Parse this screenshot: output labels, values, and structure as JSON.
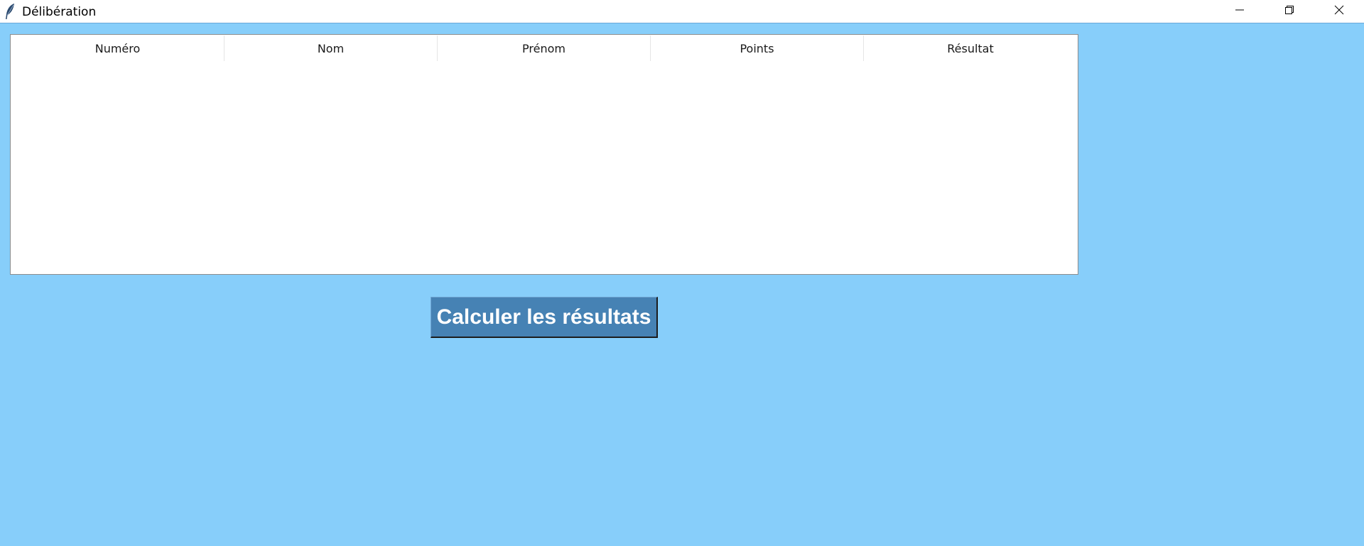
{
  "window": {
    "title": "Délibération",
    "icon": "feather-icon",
    "controls": [
      "minimize-icon",
      "restore-icon",
      "close-icon"
    ]
  },
  "table": {
    "columns": [
      "Numéro",
      "Nom",
      "Prénom",
      "Points",
      "Résultat"
    ],
    "rows": []
  },
  "actions": {
    "calculate_label": "Calculer les résultats"
  },
  "colors": {
    "background": "#87cefa",
    "button": "#4682b4",
    "button_text": "#ffffff",
    "table_background": "#ffffff"
  }
}
